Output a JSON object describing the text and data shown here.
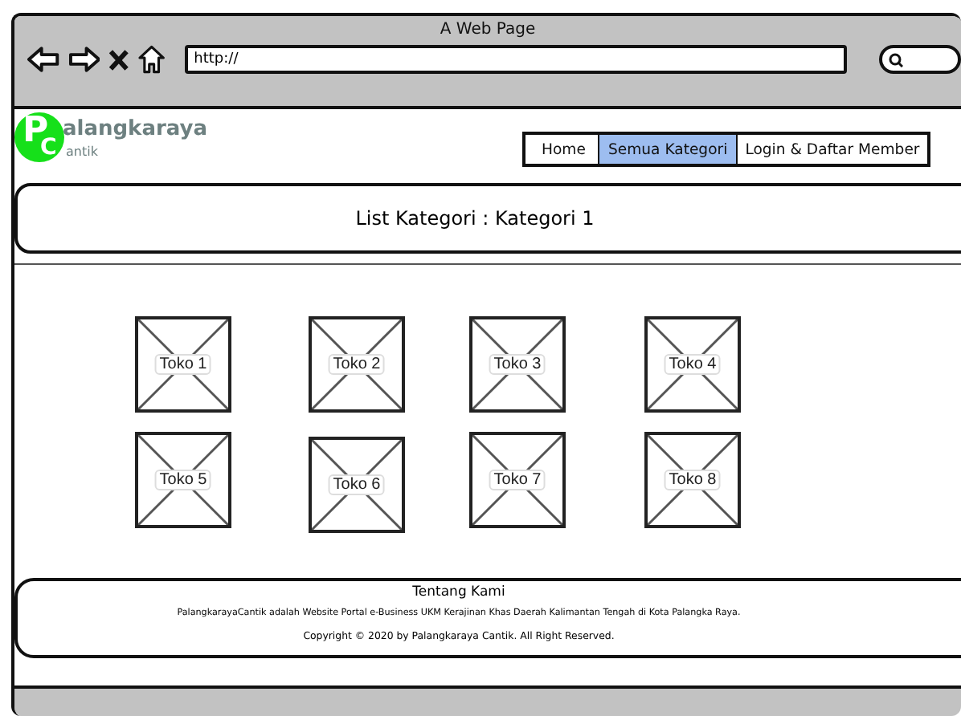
{
  "window": {
    "title": "A Web Page",
    "address": "http://"
  },
  "logo": {
    "initial_1": "P",
    "initial_2": "C",
    "word_1": "alangkaraya",
    "word_2": "antik"
  },
  "menu": [
    {
      "label": "Home",
      "selected": false
    },
    {
      "label": "Semua Kategori",
      "selected": true
    },
    {
      "label": "Login & Daftar Member",
      "selected": false
    }
  ],
  "heading": "List Kategori : Kategori 1",
  "stores": [
    {
      "label": "Toko 1"
    },
    {
      "label": "Toko 2"
    },
    {
      "label": "Toko 3"
    },
    {
      "label": "Toko 4"
    },
    {
      "label": "Toko 5"
    },
    {
      "label": "Toko 6"
    },
    {
      "label": "Toko 7"
    },
    {
      "label": "Toko 8"
    }
  ],
  "footer": {
    "title": "Tentang Kami",
    "description": "PalangkarayaCantik adalah Website Portal e-Business UKM Kerajinan Khas Daerah Kalimantan Tengah di Kota Palangka Raya.",
    "copyright": "Copyright © 2020 by Palangkaraya Cantik. All Right Reserved."
  }
}
